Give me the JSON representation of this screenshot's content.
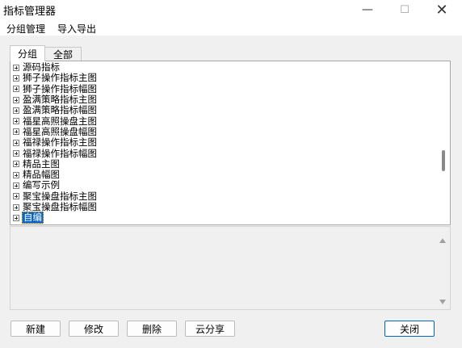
{
  "window": {
    "title": "指标管理器",
    "minimize_glyph": "—",
    "maximize_glyph": "☐",
    "close_glyph": "✕"
  },
  "menu": {
    "group_manage": "分组管理",
    "import_export": "导入导出"
  },
  "tabs": {
    "group": "分组",
    "all": "全部"
  },
  "tree": {
    "items": [
      {
        "label": "源码指标"
      },
      {
        "label": "狮子操作指标主图"
      },
      {
        "label": "狮子操作指标幅图"
      },
      {
        "label": "盈满策略指标主图"
      },
      {
        "label": "盈满策略指标幅图"
      },
      {
        "label": "福星高照操盘主图"
      },
      {
        "label": "福星高照操盘幅图"
      },
      {
        "label": "福禄操作指标主图"
      },
      {
        "label": "福禄操作指标幅图"
      },
      {
        "label": "精品主图"
      },
      {
        "label": "精品幅图"
      },
      {
        "label": "编写示例"
      },
      {
        "label": "聚宝操盘指标主图"
      },
      {
        "label": "聚宝操盘指标幅图"
      },
      {
        "label": "自编",
        "selected": true
      }
    ]
  },
  "buttons": {
    "new": "新建",
    "edit": "修改",
    "delete": "删除",
    "cloud_share": "云分享",
    "close": "关闭"
  },
  "colors": {
    "selection": "#0a64c8",
    "primary_border": "#0067c0"
  }
}
